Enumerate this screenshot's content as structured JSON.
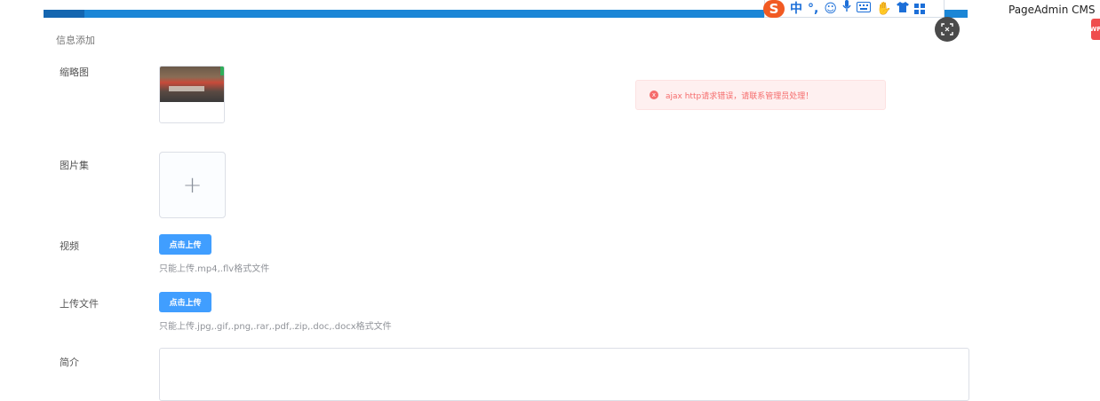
{
  "header": {
    "brand": "PageAdmin CMS",
    "side_tab": "WP"
  },
  "ime_toolbar": {
    "logo": "S",
    "mode": "中",
    "punct": "°,",
    "icons": [
      "emoji-icon",
      "mic-icon",
      "keyboard-icon",
      "hand-icon",
      "shirt-icon",
      "grid-icon"
    ]
  },
  "page": {
    "title": "信息添加"
  },
  "form": {
    "thumbnail_label": "缩略图",
    "gallery_label": "图片集",
    "gallery_add": "+",
    "video_label": "视频",
    "video_button": "点击上传",
    "video_tip": "只能上传.mp4,.flv格式文件",
    "file_label": "上传文件",
    "file_button": "点击上传",
    "file_tip": "只能上传.jpg,.gif,.png,.rar,.pdf,.zip,.doc,.docx格式文件",
    "intro_label": "简介"
  },
  "alert": {
    "message": "ajax http请求错误，请联系管理员处理！",
    "icon": "x",
    "color": "#f56c6c"
  },
  "colors": {
    "primary": "#409eff",
    "topbar": "#1b86d6",
    "error": "#f56c6c"
  }
}
